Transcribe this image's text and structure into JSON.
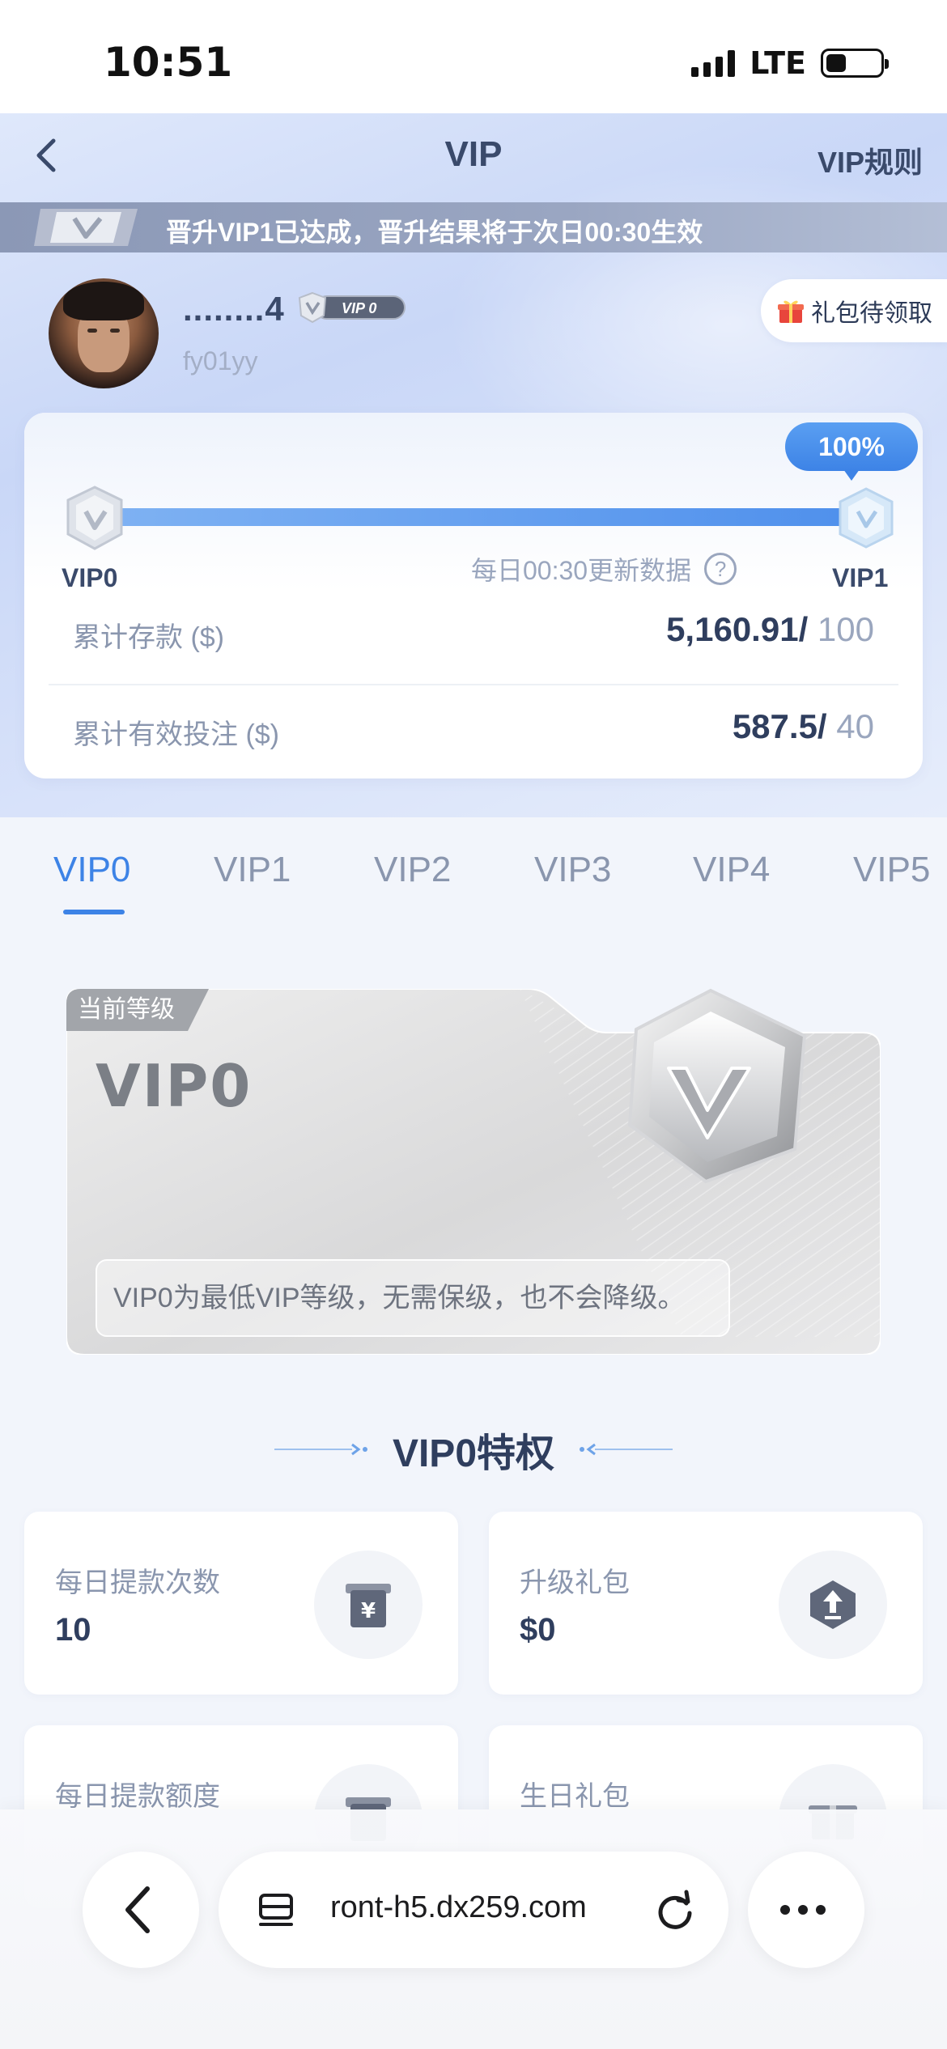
{
  "status_bar": {
    "time": "10:51",
    "network": "LTE"
  },
  "nav": {
    "title": "VIP",
    "rules_label": "VIP规则",
    "back_icon": "chevron-left-icon"
  },
  "notice": {
    "text": "晋升VIP1已达成，晋升结果将于次日00:30生效"
  },
  "profile": {
    "name": "........4",
    "vip_badge": "VIP 0",
    "user_id": "fy01yy",
    "gift_label": "礼包待领取"
  },
  "progress": {
    "percent_label": "100%",
    "percent": 100,
    "start_level": "VIP0",
    "end_level": "VIP1",
    "update_note": "每日00:30更新数据",
    "help_glyph": "?",
    "stats": [
      {
        "label": "累计存款 ($)",
        "value": "5,160.91/",
        "target": " 100"
      },
      {
        "label": "累计有效投注 ($)",
        "value": "587.5/",
        "target": " 40"
      }
    ]
  },
  "tabs": [
    "VIP0",
    "VIP1",
    "VIP2",
    "VIP3",
    "VIP4",
    "VIP5"
  ],
  "active_tab": 0,
  "level_card": {
    "tag": "当前等级",
    "level": "VIP0",
    "description": "VIP0为最低VIP等级，无需保级，也不会降级。"
  },
  "privileges": {
    "title": "VIP0特权",
    "items": [
      {
        "label": "每日提款次数",
        "value": "10",
        "icon": "withdraw-yen-icon"
      },
      {
        "label": "升级礼包",
        "value": "$0",
        "icon": "upgrade-arrow-icon"
      },
      {
        "label": "每日提款额度",
        "value": "",
        "icon": "withdraw-limit-icon"
      },
      {
        "label": "生日礼包",
        "value": "",
        "icon": "birthday-gift-icon"
      }
    ]
  },
  "browser": {
    "url": "ront-h5.dx259.com",
    "back_icon": "chevron-left-icon",
    "reload_icon": "reload-icon",
    "more_icon": "more-dots-icon"
  },
  "colors": {
    "accent": "#3d83e6",
    "text_primary": "#2f3e5e",
    "text_secondary": "#8a96ae",
    "notice_bg": "#8b98b6"
  }
}
